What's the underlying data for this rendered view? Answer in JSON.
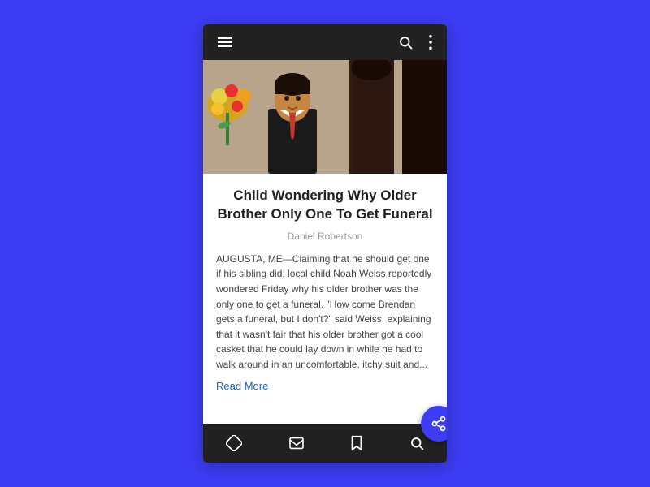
{
  "app": {
    "bg_color": "#3d3df5"
  },
  "top_nav": {
    "menu_icon": "hamburger-menu",
    "search_icon": "search",
    "more_icon": "more-vertical"
  },
  "article": {
    "title": "Child Wondering Why Older Brother Only One To Get Funeral",
    "author": "Daniel Robertson",
    "body": "AUGUSTA, ME—Claiming that he should get one if his sibling did, local child Noah Weiss reportedly wondered Friday why his older brother was the only one to get a funeral. \"How come Brendan gets a funeral, but I don't?\" said Weiss, explaining that it wasn't fair that his older brother got a cool casket that he could lay down in while he had to walk around in an uncomfortable, itchy suit and...",
    "read_more_label": "Read More"
  },
  "bottom_nav": {
    "home_icon": "home-diamond",
    "mail_icon": "mail",
    "bookmark_icon": "bookmark",
    "search_icon": "search"
  },
  "fab": {
    "share_icon": "share"
  }
}
